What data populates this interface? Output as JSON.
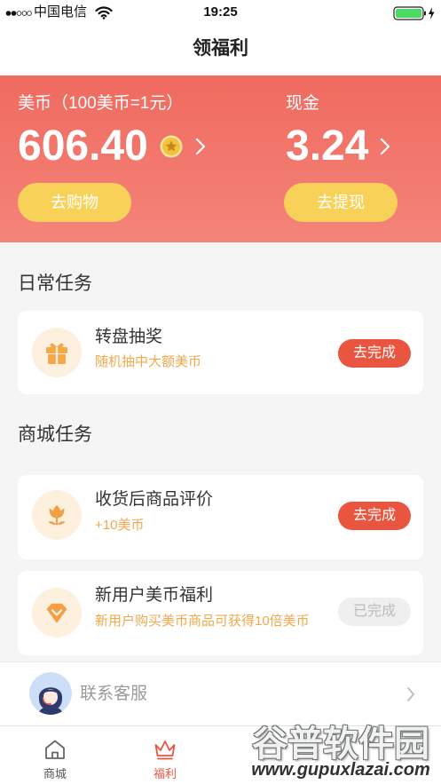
{
  "status_bar": {
    "carrier": "中国电信",
    "time": "19:25",
    "icons": [
      "signal-icon",
      "wifi-icon",
      "battery-icon",
      "charging-icon"
    ]
  },
  "nav": {
    "title": "领福利"
  },
  "banner": {
    "coins": {
      "label": "美币（100美币=1元）",
      "value": "606.40",
      "icon": "coin-star-icon",
      "button": "去购物"
    },
    "cash": {
      "label": "现金",
      "value": "3.24",
      "button": "去提现"
    }
  },
  "daily": {
    "title": "日常任务",
    "tasks": [
      {
        "name": "转盘抽奖",
        "desc": "随机抽中大额美币",
        "action": "去完成",
        "icon": "gift-icon",
        "done": false
      }
    ]
  },
  "mall": {
    "title": "商城任务",
    "tasks": [
      {
        "name": "收货后商品评价",
        "desc": "+10美币",
        "action": "去完成",
        "icon": "flower-icon",
        "done": false
      },
      {
        "name": "新用户美币福利",
        "desc": "新用户购买美币商品可获得10倍美币",
        "action": "已完成",
        "icon": "diamond-icon",
        "done": true
      }
    ]
  },
  "support": {
    "label": "联系客服",
    "icon": "customer-service-avatar"
  },
  "tabbar": {
    "items": [
      {
        "label": "商城",
        "icon": "home-icon",
        "active": false
      },
      {
        "label": "福利",
        "icon": "crown-icon",
        "active": true
      }
    ]
  },
  "watermark": {
    "brand": "谷普软件园",
    "url": "www.gupuxlazai.com"
  },
  "colors": {
    "accent_red": "#e9553f",
    "banner_top": "#f06a5f",
    "banner_bottom": "#f4847a",
    "button_yellow": "#f8d158",
    "reward_orange": "#f1a84c",
    "icon_bg": "#fdf0df",
    "done_gray": "#efefef"
  }
}
